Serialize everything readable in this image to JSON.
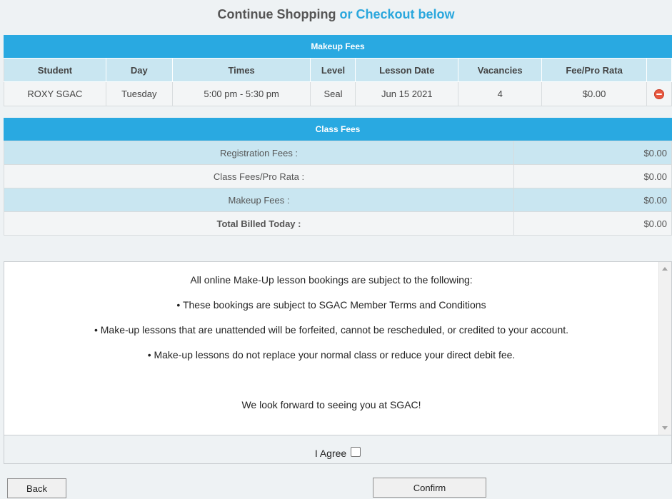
{
  "heading": {
    "continue": "Continue Shopping",
    "checkout": "or Checkout below"
  },
  "makeup": {
    "title": "Makeup Fees",
    "columns": [
      "Student",
      "Day",
      "Times",
      "Level",
      "Lesson Date",
      "Vacancies",
      "Fee/Pro Rata",
      ""
    ],
    "rows": [
      {
        "student": "ROXY SGAC",
        "day": "Tuesday",
        "times": "5:00 pm - 5:30 pm",
        "level": "Seal",
        "lesson_date": "Jun 15 2021",
        "vacancies": "4",
        "fee": "$0.00",
        "action_icon": "remove-icon"
      }
    ]
  },
  "class_fees": {
    "title": "Class Fees",
    "rows": [
      {
        "label": "Registration Fees :",
        "amount": "$0.00"
      },
      {
        "label": "Class Fees/Pro Rata :",
        "amount": "$0.00"
      },
      {
        "label": "Makeup Fees :",
        "amount": "$0.00"
      },
      {
        "label": "Total Billed Today :",
        "amount": "$0.00"
      }
    ]
  },
  "terms": {
    "intro": "All online Make-Up lesson bookings are subject to the following:",
    "bullets": [
      "• These bookings are subject to SGAC Member Terms and Conditions",
      "• Make-up lessons that are unattended will be forfeited, cannot be rescheduled, or credited to your account.",
      "• Make-up lessons do not replace your normal class or reduce your direct debit fee."
    ],
    "closing": "We look forward to seeing you at SGAC!"
  },
  "agree": {
    "label": "I Agree",
    "checked": false
  },
  "buttons": {
    "back": "Back",
    "confirm": "Confirm"
  },
  "colors": {
    "accent": "#29a9e1",
    "header_row": "#c9e6f1",
    "remove": "#e8573f"
  }
}
